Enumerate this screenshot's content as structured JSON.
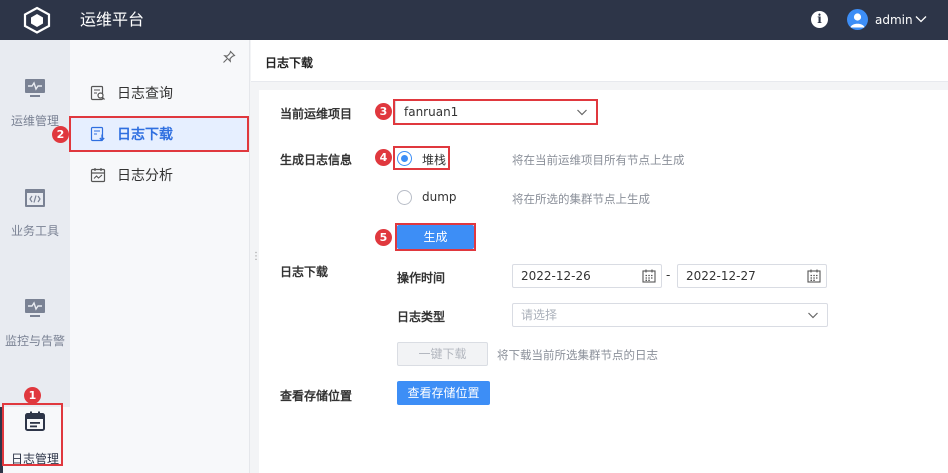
{
  "header": {
    "app_title": "运维平台",
    "user": "admin",
    "icons": [
      "cube-logo-icon",
      "info-icon",
      "user-avatar-icon",
      "chevron-down-icon"
    ]
  },
  "rail": {
    "items": [
      {
        "label": "运维管理",
        "icon": "monitor-pulse-icon"
      },
      {
        "label": "业务工具",
        "icon": "code-window-icon"
      },
      {
        "label": "监控与告警",
        "icon": "monitor-alert-icon"
      },
      {
        "label": "日志管理",
        "icon": "calendar-list-icon",
        "active": true
      }
    ]
  },
  "submenu": {
    "items": [
      {
        "label": "日志查询",
        "icon": "log-search-icon"
      },
      {
        "label": "日志下载",
        "icon": "log-download-icon",
        "active": true
      },
      {
        "label": "日志分析",
        "icon": "log-analysis-icon"
      }
    ]
  },
  "main": {
    "title": "日志下载",
    "project": {
      "label": "当前运维项目",
      "value": "fanruan1"
    },
    "generate": {
      "label": "生成日志信息",
      "options": [
        {
          "label": "堆栈",
          "hint": "将在当前运维项目所有节点上生成",
          "selected": true
        },
        {
          "label": "dump",
          "hint": "将在所选的集群节点上生成",
          "selected": false
        }
      ],
      "button": "生成"
    },
    "download": {
      "label": "日志下载",
      "time_label": "操作时间",
      "date_from": "2022-12-26",
      "date_sep": "-",
      "date_to": "2022-12-27",
      "type_label": "日志类型",
      "type_placeholder": "请选择",
      "button": "一键下载",
      "button_hint": "将下载当前所选集群节点的日志"
    },
    "storage": {
      "label": "查看存储位置",
      "button": "查看存储位置"
    }
  },
  "annotations": {
    "badges": [
      "1",
      "2",
      "3",
      "4",
      "5"
    ],
    "color": "#e0383e"
  },
  "colors": {
    "topbar": "#2d3548",
    "accent": "#3d8ef6",
    "active_menu_bg": "#e6efff"
  }
}
